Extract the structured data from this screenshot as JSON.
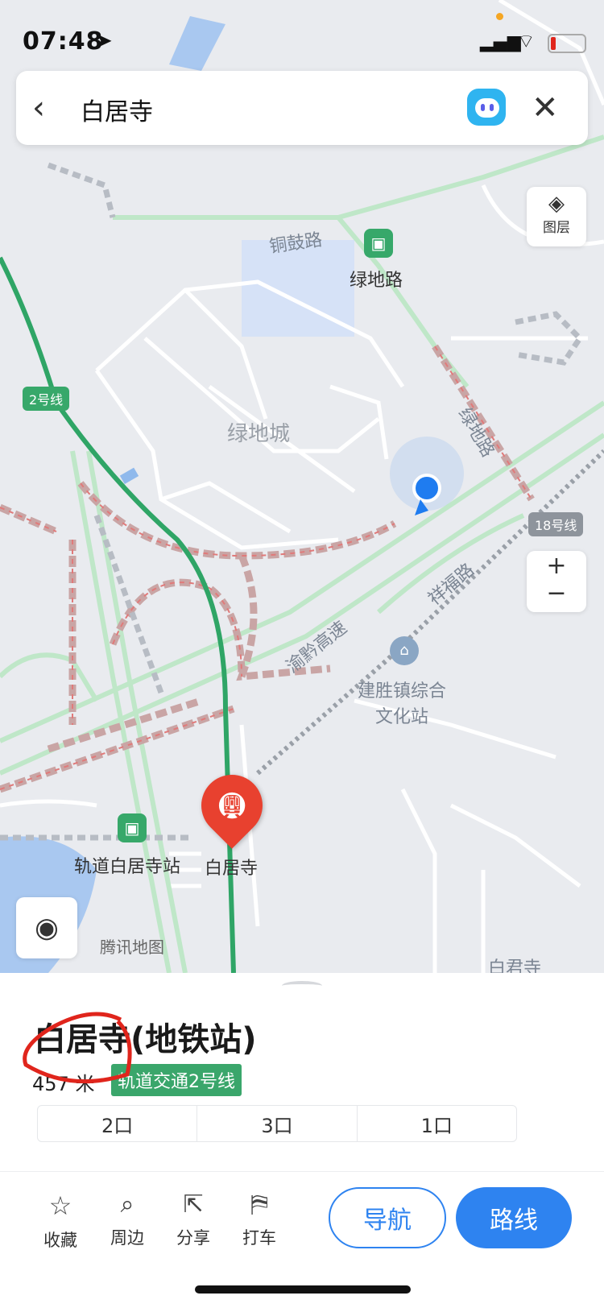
{
  "status_bar": {
    "time": "07:48"
  },
  "search": {
    "query": "白居寺",
    "back_icon": "chevron-left-icon",
    "assistant_icon": "assistant-face-icon",
    "close_icon": "close-icon"
  },
  "map": {
    "layers_label": "图层",
    "zoom_in": "+",
    "zoom_out": "−",
    "labels": {
      "tonggu_road": "铜鼓路",
      "lvdi_road_bus": "绿地路",
      "lvdi_city": "绿地城",
      "lvdi_road_vertical": "绿地路",
      "line2": "2号线",
      "line18": "18号线",
      "xiangfu_road": "祥福路",
      "yuqian_expressway": "渝黔高速",
      "culture_station": "建胜镇综合\n文化站",
      "rail_station_bus": "轨道白居寺站",
      "baijusi": "白居寺",
      "tencent_map": "腾讯地图",
      "baijunsi": "白君寺"
    }
  },
  "place": {
    "title": "白居寺(地铁站)",
    "distance": "457 米",
    "line_tag": "轨道交通2号线",
    "exits": [
      "2口",
      "3口",
      "1口"
    ]
  },
  "actions": {
    "collect": "收藏",
    "nearby": "周边",
    "share": "分享",
    "taxi": "打车",
    "navigate": "导航",
    "route": "路线"
  },
  "colors": {
    "accent": "#2e83f0",
    "line_green": "#37a86a",
    "annotation_red": "#e0251c"
  }
}
